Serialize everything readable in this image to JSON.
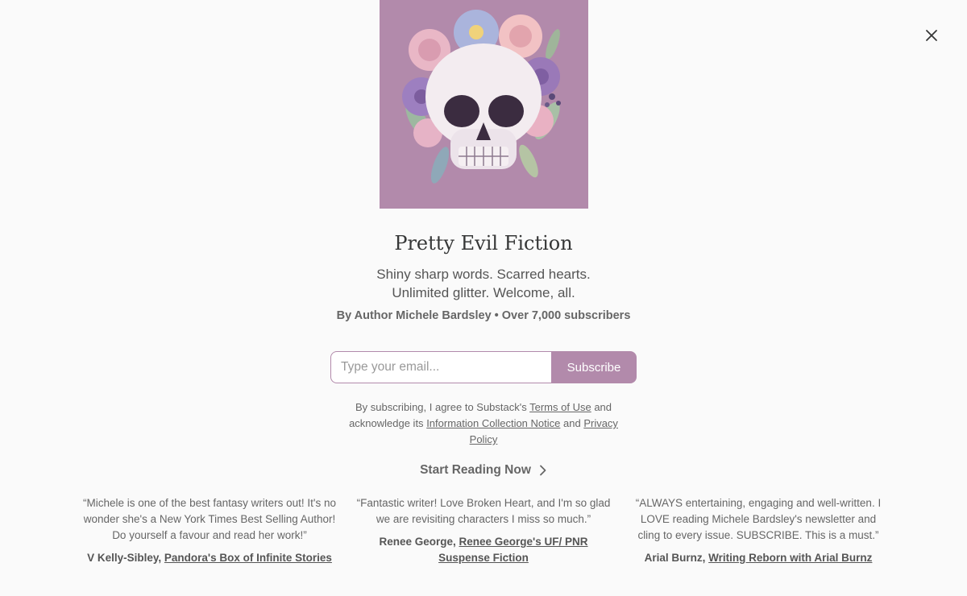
{
  "publication": {
    "title": "Pretty Evil Fiction",
    "tagline_line1": "Shiny sharp words. Scarred hearts.",
    "tagline_line2": "Unlimited glitter. Welcome, all.",
    "byline": "By Author Michele Bardsley • Over 7,000 subscribers",
    "cover_bg_color": "#b28aab"
  },
  "subscribe_form": {
    "email_placeholder": "Type your email...",
    "button_label": "Subscribe",
    "accent_color": "#b28aab"
  },
  "legal": {
    "text1": "By subscribing, I agree to Substack's ",
    "terms_link": "Terms of Use",
    "text2": " and acknowledge its ",
    "info_link": "Information Collection Notice",
    "text3": " and ",
    "privacy_link": "Privacy Policy"
  },
  "start_reading": {
    "label": "Start Reading Now",
    "icon": "chevron-right-icon"
  },
  "testimonials": [
    {
      "quote": "“Michele is one of the best fantasy writers out! It's no wonder she's a New York Times Best Selling Author! Do yourself a favour and read her work!”",
      "author": "V Kelly-Sibley",
      "publication": "Pandora's Box of Infinite Stories"
    },
    {
      "quote": "“Fantastic writer! Love Broken Heart, and I'm so glad we are revisiting characters I miss so much.”",
      "author": "Renee George",
      "publication": "Renee George's UF/ PNR Suspense Fiction"
    },
    {
      "quote": "“ALWAYS entertaining, engaging and well-written. I LOVE reading Michele Bardsley's newsletter and cling to every issue. SUBSCRIBE. This is a must.”",
      "author": "Arial Burnz",
      "publication": "Writing Reborn with Arial Burnz"
    }
  ],
  "close_icon": "close-icon"
}
